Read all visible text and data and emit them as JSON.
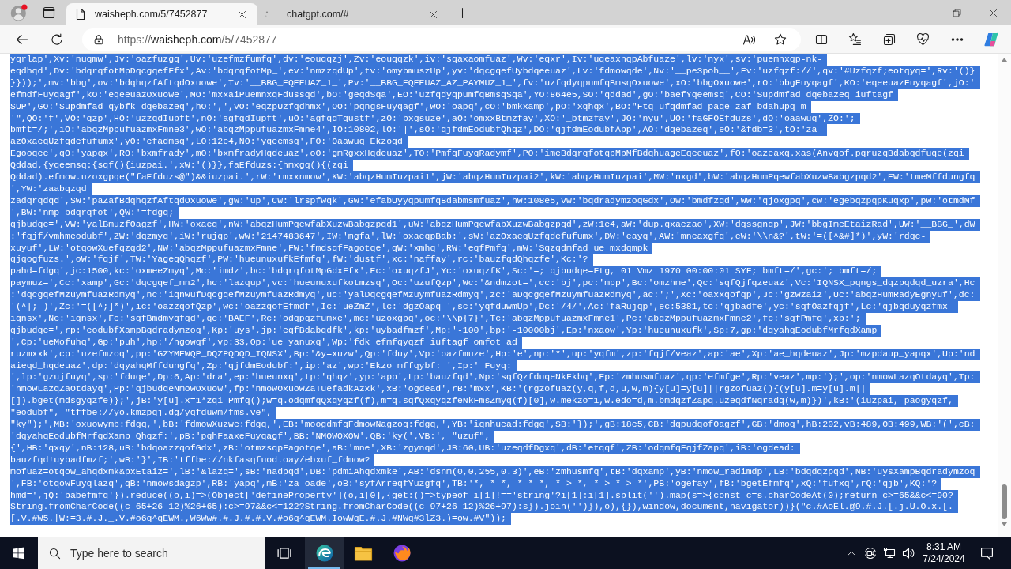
{
  "browser": {
    "tabs": [
      {
        "title": "waisheph.com/5/7452877",
        "selected": true,
        "kind": "page"
      },
      {
        "title": "chatgpt.com/#",
        "selected": false,
        "kind": "loading"
      }
    ],
    "url": {
      "scheme": "https://",
      "host": "waisheph.com",
      "path": "/5/7452877"
    }
  },
  "page": {
    "selected": true,
    "lines": [
      "yqrlap',Xv:'nuqmw',Jv:'oazfuzgq',Uv:'uzefmzfumfq',dv:'eouqqzj',Zv:'eouqqzk',iv:'sqaxaomfuaz',Wv:'eqxr',Iv:'uqeaxnqpAbfuaze',lv:'nyx',sv:'puemnxqp-nk-",
      "eqdhqd',Dv:'bdqrqfotMpDqcgqefFfx',Av:'bdqrqfotMp_',ev:'nmzzqdUp',tv:'omybmuszUp',yv:'dqcgqefUybdqeeuaz',Lv:'fdmowqde',Nv:'__pe3poh__',Fv:'uzfqzf://',qv:'#Uzfqzf;eotqyq=',Rv:'()}",
      "}}));',mv:'bbg',ov:'bdqhqzfAftqdOxuowe',Tv:'__BBG_EQEEUAZ_1_',Pv:'__BBG_EQEEUAZ_AZ_PAYMUZ_1_',fv:'uzfqdyqpumfqBmsqOxuowe',xO:'bbgOxuowe',rO:'bbgFuyqagf',KO:'eqeeuazFuyqagf',jO:'",
      "efmdfFuyqagf',kO:'eqeeuazOxuowe',MO:'mxxaiPuemnxqFdussqd',bO:'geqdSqa',EO:'uzfqdyqpumfqBmsqSqa',YO:864e5,SO:'qddad',gO:'baefYqeemsq',CO:'Supdmfad dqebazeq iuftagf",
      "SUP',GO:'Supdmfad qybfk dqebazeq',hO:',',vO:'eqzpUzfqdhmx',OO:'pqngsFuyqagf',WO:'oapq',cO:'bmkxamp',pO:'xqhqx',BO:\"Ftq ufqdmfad paqe zaf bdahupq m",
      "'\",QO:'f',VO:'qzp',HO:'uzzqdIupft',nO:'agfqdIupft',uO:'agfqdTqustf',zO:'bxgsuze',aO:'omxxBtmzfay',XO:'_btmzfay',JO:'nyu',UO:'faGFOEfduzs',dO:'oaawuq',ZO:';",
      "bmft=/;',iO:'abqzMppufuazmxFmne3',wO:'abqzMppufuazmxFmne4',IO:10802,lO:'|',sO:'qjfdmEodubfQhqz',DO:'qjfdmEodubfApp',AO:'dqebazeq',eO:'&fdb=3',tO:'za-",
      "azOxaeqUzfqdefufumx',yO:'efadmsq',LO:12e4,NO:'yqeemsq',FO:'Oaawuq Ekzoqd",
      "Egooqee',qO:'yapqx',RO:'bxmfrady',mO:'bxmfradyHqdeuaz',oO:'gmRgxxHqdeuaz',TO:'PmfqFuyqRadymf',PO:'imeBdqrqfotqpMpMfBdqhuageEqeeuaz',fO:'oazeaxq.xas(Anvqof.pqruzqBdabqdfuqe(zqi",
      "Qddad,{yqeemsq:{sqf(){iuzpai.',xW:'()}},faEfduzs:{hmxgq(){(zqi",
      "Qddad).efmow.uzoxgpqe(\"faEfduzs@\")&&iuzpai.',rW:'rmxxnmow',KW:'abqzHumIuzpai1',jW:'abqzHumIuzpai2',kW:'abqzHumIuzpai',MW:'nxgd',bW:'abqzHumPqewfabXuzwBabgzpqd2',EW:'tmeMffdungfq",
      "',YW:'zaabqzqd",
      "zadqrqdqd',SW:'paZafBdqhqzfAftqdOxuowe',gW:'up',CW:'lrspfwqk',GW:'efabUyyqpumfqBdabmsmfuaz',hW:108e5,vW:'bqdradymzoqGdx',OW:'bmdfzqd',WW:'qjoxgpq',cW:'egebqzpqpKuqxp',pW:'otmdMf",
      "',BW:'nmp-bdqrqfot',QW:'=fdgq;",
      "qjbudqe=',VW:'yalBmuzfOagzf',HW:'oxaeq',nW:'abqzHumPqewfabXuzwBabgzpqd1',uW:'abqzHumPqewfabXuzwBabgzpqd',zW:1e4,aW:'dup.qxaezao',XW:'dqssgnqp',JW:'bbgImeEtaizRad',UW:'__BBG_',dW",
      ":'fqjf/vmhmeodubf',ZW:'dqzmyq',iW:'rujqp',wW:'2147483647',IW:'mgfa',lW:'oxaeqpBab:',sW:'azOxaeqUzfqdefufumx',DW:'eayq',AW:'mneaxgfq',eW:'\\\\n&?',tW:'=([^&#]*)',yW:'rdqc-",
      "xuyuf',LW:'otqowXuefqzqd2',NW:'abqzMppufuazmxFmne',FW:'fmdsqfFagotqe',qW:'xmhq',RW:'eqfPmfq',mW:'Sqzqdmfad ue mxdqmpk",
      "qjqogfuzs.',oW:'fqjf',TW:'YageqQhqzf',PW:'hueunuxufkEfmfq',fW:'dustf',xc:'naffay',rc:'bauzfqdQhqzfe',Kc:'?",
      "pahd=fdgq',jc:1500,kc:'oxmeeZmyq',Mc:'imdz',bc:'bdqrqfotMpGdxFfx',Ec:'oxuqzfJ',Yc:'oxuqzfK',Sc:'=; qjbudqe=Ftg, 01 Vmz 1970 00:00:01 SYF; bmft=/',gc:'; bmft=/;",
      "paymuz=',Cc:'xamp',Gc:'dqcgqef_mn2',hc:'lazqup',vc:'hueunuxufkotmzsq',Oc:'uzufQzp',Wc:'&ndmzot=',cc:'bj',pc:'mpp',Bc:'omzhme',Qc:'sqfQjfqzeuaz',Vc:'IQNSX_pqngs_dqzpqdqd_uzra',Hc",
      ":'dqcgqefMzuymfuazRdmyq',nc:'iqnwufDqcgqefMzuymfuazRdmyq',uc:'yalDqcgqefMzuymfuazRdmyq',zc:'aDqcgqefMzuymfuazRdmyq',ac:';',Xc:'oaxxqofqp',Jc:'gzwzaiz',Uc:'abqzHumRadyEgnyuf',dc:",
      "'(^|; )',Zc:'=([^;]*)',ic:'oazzqofQzp',wc:'oazzqofEfmdf',Ic:'ueZmZ',lc:'dgzOapq ',sc:'yqfduwmUp',Dc:'/4/',Ac:'faRujqp',ec:5381,tc:'qjbadfe',yc:'sqfOazfqjf',Lc:'qjbqduyqzfmx-",
      "iqnsx',Nc:'iqnsx',Fc:'sqfBmdmyqfqd',qc:'BAEF',Rc:'odqpqzfumxe',mc:'uzoxgpq',oc:'\\\\p{7}',Tc:'abqzMppufuazmxFmne1',Pc:'abqzMppufuazmxFmne2',fc:'sqfPmfq',xp:';",
      "qjbudqe=',rp:'eodubfXampBqdradymzoq',Kp:'uys',jp:'eqfBdabqdfk',kp:'uybadfmzf',Mp:'-100',bp:'-10000bj',Ep:'nxaow',Yp:'hueunuxufk',Sp:7,gp:'dqyahqEodubfMrfqdXamp",
      "',Cp:'ueMofuhq',Gp:'puh',hp:'/ngowqf',vp:33,Op:'ue_yanuxq',Wp:'fdk efmfqyqzf iuftagf omfot ad",
      "ruzmxxk',cp:'uzefmzoq',pp:'GZYMEWQP_DQZPQDQD_IQNSX',Bp:'&y=xuzw',Qp:'fduy',Vp:'oazfmuze',Hp:'e',np:'*',up:'yqfm',zp:'fqjf/veaz',ap:'ae',Xp:'ae_hqdeuaz',Jp:'mzpdaup_yapqx',Up:'nd",
      "aieqd_hqdeuaz',dp:'dqyahqMffdungfq',Zp:'qjfdmEodubf:',ip:'az',wp:'Ekzo mffqybf: ',Ip:' Fuyq:",
      "',lp:'gzujfuyq',sp:'fduqe',Dp:6,Ap:'dra',ep:'hueunxq',tp:'qhqz',yp:'app',Lp:'bauzfqd',Np:'sqfQzfduqeNkFkbq',Fp:'zmhusmfuaz',qp:'efmfge',Rp:'veaz',mp:');',op:'nmowLazqOtdayq',Tp:",
      "'nmowLazqZaOtdayq',Pp:'qjbudqeNmowOxuow',fp:'nmowOxuowZaTuefadkAzxk',xB:'ogdead',rB:'mxx',KB:'(rgzofuaz(y,q,f,d,u,w,m){y[u]=y[u]||rgzofuaz(){(y[u].m=y[u].m||",
      "[]).bget(mdsgyqzfe)};',jB:'y[u].x=1*zqi Pmfq();w=q.odqmfqQxqyqzf(f),m=q.sqfQxqyqzfeNkFmsZmyq(f)[0],w.mekzo=1,w.edo=d,m.bmdqzfZapq.uzeqdfNqradq(w,m)})',kB:'(iuzpai, paogyqzf,",
      "\"eodubf\", \"tffbe://yo.kmzpqj.dg/yqfduwm/fms.ve\",",
      "\"ky\");',MB:'oxuowymb:fdgq,',bB:'fdmowXuzwe:fdgq,',EB:'moogdmfqFdmowNagzoq:fdgq,',YB:'iqnhuead:fdgq',SB:'});',gB:18e5,CB:'dqpudqofOagzf',GB:'dmoq',hB:202,vB:489,OB:499,WB:'(',cB:",
      "'dqyahqEodubfMrfqdXamp Qhqzf:',pB:'pqhFaaxeFuyqagf',BB:'NMOWOXOW',QB:'ky(',VB:', \"uzuf\",",
      "{',HB:'qxqy',nB:128,uB:'bdqoazzqofGdx',zB:'otmzsqpFagotqe',aB:'mne',XB:'zgynqd',JB:60,UB:'uzeqdfDgxq',dB:'etqqf',ZB:'odqmfqFqjfZapq',iB:'ogdead:",
      "bauzfqd!uybadfmzf;',wB:'}',IB:'tffbe://nkfasqfuod.oay/ebxuf_fdmow?",
      "mofuaz=otqow_ahqdxmk&pxEtaiz=',lB:'&lazq=',sB:'nadpqd',DB:'pdmiAhqdxmke',AB:'dsnm(0,0,255,0.3)',eB:'zmhusmfq',tB:'dqxamp',yB:'nmow_radimdp',LB:'bdqdqzpqd',NB:'uysXampBqdradymzoq",
      "',FB:'otqowFuyqlazq',qB:'nmowsdagzp',RB:'yapq',mB:'za-oade',oB:'syfArreqfYuzgfq',TB:'*, * *, * * *, * > *, * > * > *',PB:'ogefay',fB:'bgetEfmfq',xQ:'fufxq',rQ:'qjb',KQ:'?",
      "hmd=',jQ:'babefmfq'}).reduce((o,i)=>(Object['defineProperty'](o,i[0],{get:()=>typeof i[1]!=='string'?i[1]:i[1].split('').map(s=>{const c=s.charCodeAt(0);return c>=65&&c<=90?",
      "String.fromCharCode((c-65+26-12)%26+65):c>=97&&c<=122?String.fromCharCode((c-97+26-12)%26+97):s}).join('')}),o),{}),window,document,navigator))}(\"c.#AoEl.@9.#.J.[.j.U.O.x.[.",
      "[.V.#W5.|W:=3.#.J._.V.#o6q^qEWM.,W6Ww#.#.J.#.#.V.#o6q^qEWM.IowWqE.#.J.#NWq#3lZ3.)=ow.#V\"));"
    ]
  },
  "taskbar": {
    "search": {
      "placeholder": "Type here to search"
    },
    "apps": [
      {
        "kind": "browser",
        "running": true
      },
      {
        "kind": "folder",
        "running": false
      },
      {
        "kind": "fox",
        "running": false
      }
    ],
    "time": "8:31 AM",
    "date": "7/24/2024"
  }
}
